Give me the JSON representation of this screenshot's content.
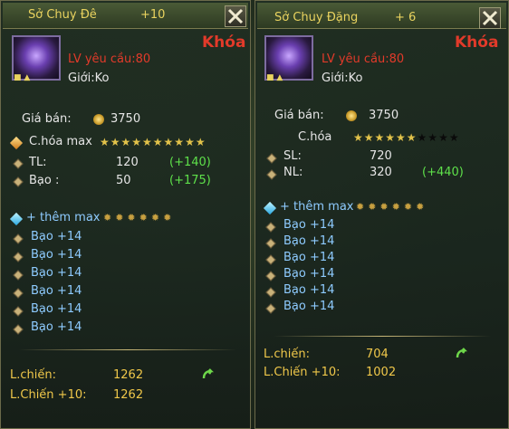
{
  "left_panel": {
    "title": "Sở Chuy Đê",
    "plus": "+10",
    "lock": "Khóa",
    "level_req": "LV yêu cầu:80",
    "gender": "Giới:Ko",
    "price_label": "Giá bán:",
    "price": "3750",
    "upgrade_label": "C.hóa max",
    "upgrade_stars_filled": 10,
    "upgrade_stars_total": 10,
    "stats": [
      {
        "label": "TL:",
        "value": "120",
        "bonus": "(+140)"
      },
      {
        "label": "Bạo :",
        "value": "50",
        "bonus": "(+175)"
      }
    ],
    "extra_label": "+ thêm max",
    "extra_slots": 6,
    "extras": [
      "Bạo +14",
      "Bạo +14",
      "Bạo +14",
      "Bạo +14",
      "Bạo +14",
      "Bạo +14"
    ],
    "power_label": "L.chiến:",
    "power": "1262",
    "power10_label": "L.Chiến +10:",
    "power10": "1262"
  },
  "right_panel": {
    "title": "Sở Chuy Đặng",
    "plus": "+ 6",
    "lock": "Khóa",
    "level_req": "LV yêu cầu:80",
    "gender": "Giới:Ko",
    "price_label": "Giá bán:",
    "price": "3750",
    "upgrade_label": "C.hóa",
    "upgrade_stars_filled": 6,
    "upgrade_stars_total": 10,
    "stats": [
      {
        "label": "SL:",
        "value": "720",
        "bonus": ""
      },
      {
        "label": "NL:",
        "value": "320",
        "bonus": "(+440)"
      }
    ],
    "extra_label": "+ thêm max",
    "extra_slots": 6,
    "extras": [
      "Bạo +14",
      "Bạo +14",
      "Bạo +14",
      "Bạo +14",
      "Bạo +14",
      "Bạo +14"
    ],
    "power_label": "L.chiến:",
    "power": "704",
    "power10_label": "L.Chiến +10:",
    "power10": "1002"
  },
  "colors": {
    "title": "#e9d35f",
    "lock": "#e23a2a",
    "bonus": "#5ee04a",
    "extra": "#8ecbff"
  }
}
